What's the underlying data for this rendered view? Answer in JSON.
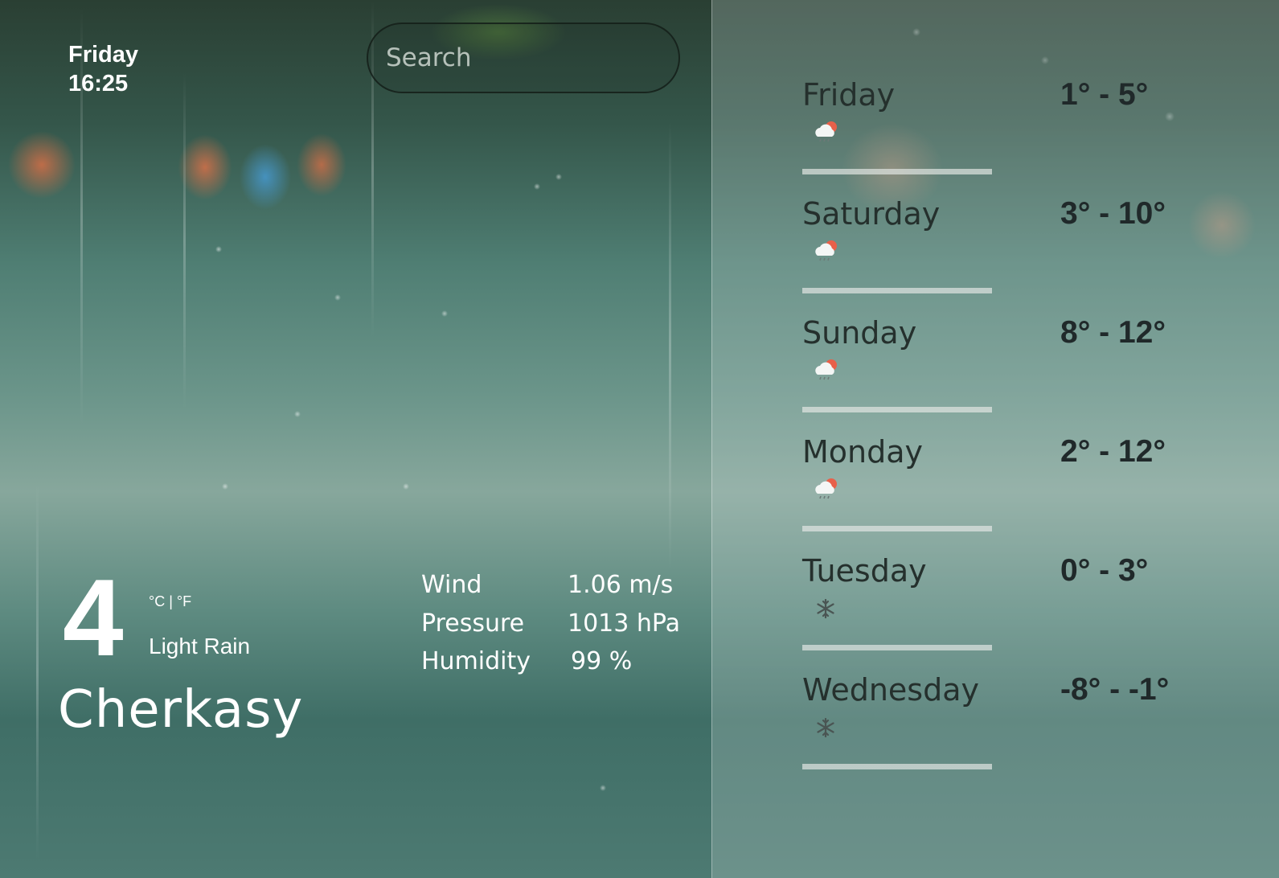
{
  "header": {
    "day": "Friday",
    "time": "16:25"
  },
  "search": {
    "placeholder": "Search",
    "value": "",
    "icon": "location-pin-icon"
  },
  "current": {
    "temperature": "4",
    "units_label": "°C | °F",
    "unit_celsius": "°C",
    "unit_separator": " | ",
    "unit_fahrenheit": "°F",
    "condition": "Light Rain",
    "city": "Cherkasy"
  },
  "details": [
    {
      "label": "Wind",
      "value": "1.06 m/s"
    },
    {
      "label": "Pressure",
      "value": "1013 hPa"
    },
    {
      "label": "Humidity",
      "value": "99 %"
    }
  ],
  "forecast": [
    {
      "day": "Friday",
      "range": "1° - 5°",
      "icon": "rain-cloud-sun-icon"
    },
    {
      "day": "Saturday",
      "range": "3° - 10°",
      "icon": "rain-cloud-sun-icon"
    },
    {
      "day": "Sunday",
      "range": "8° - 12°",
      "icon": "rain-cloud-sun-icon"
    },
    {
      "day": "Monday",
      "range": "2° - 12°",
      "icon": "rain-cloud-sun-icon"
    },
    {
      "day": "Tuesday",
      "range": "0° - 3°",
      "icon": "snowflake-icon"
    },
    {
      "day": "Wednesday",
      "range": "-8° - -1°",
      "icon": "snowflake-icon"
    }
  ],
  "colors": {
    "text_light": "#ffffff",
    "text_dark": "#25302d",
    "sun_accent": "#e8604a",
    "separator": "#e1e6e2"
  }
}
